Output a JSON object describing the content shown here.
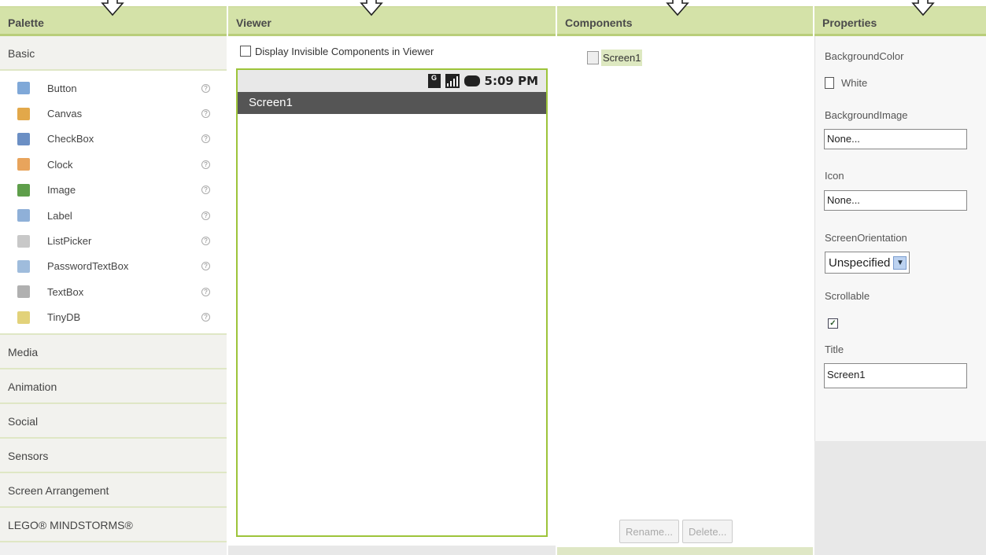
{
  "palette": {
    "title": "Palette",
    "active_category": "Basic",
    "items": [
      {
        "label": "Button",
        "icon": "button-icon",
        "color": "#7fa8d8"
      },
      {
        "label": "Canvas",
        "icon": "canvas-icon",
        "color": "#e2a84a"
      },
      {
        "label": "CheckBox",
        "icon": "checkbox-icon",
        "color": "#6b8fc4"
      },
      {
        "label": "Clock",
        "icon": "clock-icon",
        "color": "#e8a45c"
      },
      {
        "label": "Image",
        "icon": "image-icon",
        "color": "#5e9e4a"
      },
      {
        "label": "Label",
        "icon": "label-icon",
        "color": "#8fb0d8"
      },
      {
        "label": "ListPicker",
        "icon": "listpicker-icon",
        "color": "#c8c8c8"
      },
      {
        "label": "PasswordTextBox",
        "icon": "passwordtextbox-icon",
        "color": "#9fbcdc"
      },
      {
        "label": "TextBox",
        "icon": "textbox-icon",
        "color": "#b0b0b0"
      },
      {
        "label": "TinyDB",
        "icon": "tinydb-icon",
        "color": "#e2d27a"
      }
    ],
    "help_symbol": "?",
    "categories": [
      "Media",
      "Animation",
      "Social",
      "Sensors",
      "Screen Arrangement",
      "LEGO® MINDSTORMS®"
    ]
  },
  "viewer": {
    "title": "Viewer",
    "checkbox_label": "Display Invisible Components in Viewer",
    "status_time": "5:09 PM",
    "network_letter": "G",
    "screen_title": "Screen1"
  },
  "components": {
    "title": "Components",
    "tree": [
      {
        "label": "Screen1"
      }
    ],
    "rename_button": "Rename...",
    "delete_button": "Delete..."
  },
  "properties": {
    "title": "Properties",
    "background_color_label": "BackgroundColor",
    "background_color_value": "White",
    "background_image_label": "BackgroundImage",
    "background_image_value": "None...",
    "icon_label": "Icon",
    "icon_value": "None...",
    "screen_orientation_label": "ScreenOrientation",
    "screen_orientation_value": "Unspecified",
    "scrollable_label": "Scrollable",
    "scrollable_checked": true,
    "title_label": "Title",
    "title_value": "Screen1"
  },
  "colors": {
    "header_bg": "#d4e2a8",
    "phone_border": "#9dc43a",
    "title_bar": "#555555"
  }
}
